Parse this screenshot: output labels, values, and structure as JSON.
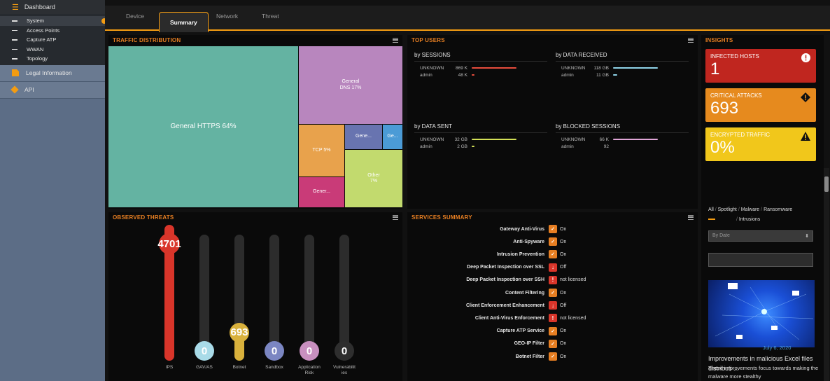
{
  "sidebar": {
    "dashboard": "Dashboard",
    "items": [
      "System",
      "Access Points",
      "Capture ATP",
      "WWAN",
      "Topology"
    ],
    "legal": "Legal Information",
    "api": "API"
  },
  "tabs": [
    "Device",
    "Summary",
    "Network",
    "Threat"
  ],
  "traffic": {
    "title": "TRAFFIC DISTRIBUTION",
    "cells": [
      "General HTTPS 64%",
      "General\nDNS 17%",
      "TCP 5%",
      "Gene...",
      "Ge...",
      "Other\n7%",
      "Gener..."
    ]
  },
  "top_users": {
    "title": "TOP USERS",
    "sections": [
      {
        "title": "by SESSIONS",
        "rows": [
          {
            "name": "UNKNOWN",
            "value": "869 K",
            "color": "#e74c3c",
            "frac": 1.0
          },
          {
            "name": "admin",
            "value": "48 K",
            "color": "#e74c3c",
            "frac": 0.055
          }
        ]
      },
      {
        "title": "by DATA RECEIVED",
        "rows": [
          {
            "name": "UNKNOWN",
            "value": "118 GB",
            "color": "#8fd3e8",
            "frac": 1.0
          },
          {
            "name": "admin",
            "value": "11 GB",
            "color": "#8fd3e8",
            "frac": 0.093
          }
        ]
      },
      {
        "title": "by DATA SENT",
        "rows": [
          {
            "name": "UNKNOWN",
            "value": "32 GB",
            "color": "#d4e157",
            "frac": 1.0
          },
          {
            "name": "admin",
            "value": "2 GB",
            "color": "#d4e157",
            "frac": 0.0625
          }
        ]
      },
      {
        "title": "by BLOCKED SESSIONS",
        "rows": [
          {
            "name": "UNKNOWN",
            "value": "66 K",
            "color": "#e1a6d8",
            "frac": 1.0
          },
          {
            "name": "admin",
            "value": "92",
            "color": "#e1a6d8",
            "frac": 0.0
          }
        ]
      }
    ]
  },
  "threats": {
    "title": "OBSERVED THREATS",
    "items": [
      {
        "label": "IPS",
        "value": "4701",
        "color": "#d9352a",
        "frac": 1.0
      },
      {
        "label": "GAV/AS",
        "value": "0",
        "color": "#a9dbe8",
        "frac": 0
      },
      {
        "label": "Botnet",
        "value": "693",
        "color": "#d9b13c",
        "frac": 0.147
      },
      {
        "label": "Sandbox",
        "value": "0",
        "color": "#7b86c2",
        "frac": 0
      },
      {
        "label": "Application\nRisk",
        "value": "0",
        "color": "#c88fbf",
        "frac": 0
      },
      {
        "label": "Vulnerabilit\nies",
        "value": "0",
        "color": "#3a3a3a",
        "frac": 0
      }
    ]
  },
  "services": {
    "title": "SERVICES SUMMARY",
    "rows": [
      {
        "name": "Gateway Anti-Virus",
        "status": "On",
        "kind": "on"
      },
      {
        "name": "Anti-Spyware",
        "status": "On",
        "kind": "on"
      },
      {
        "name": "Intrusion Prevention",
        "status": "On",
        "kind": "on"
      },
      {
        "name": "Deep Packet Inspection over SSL",
        "status": "Off",
        "kind": "off"
      },
      {
        "name": "Deep Packet Inspection over SSH",
        "status": "not licensed",
        "kind": "nl"
      },
      {
        "name": "Content Filtering",
        "status": "On",
        "kind": "on"
      },
      {
        "name": "Client Enforcement Enhancement",
        "status": "Off",
        "kind": "off"
      },
      {
        "name": "Client Anti-Virus Enforcement",
        "status": "not licensed",
        "kind": "nl"
      },
      {
        "name": "Capture ATP Service",
        "status": "On",
        "kind": "on"
      },
      {
        "name": "GEO-IP Filter",
        "status": "On",
        "kind": "on"
      },
      {
        "name": "Botnet Filter",
        "status": "On",
        "kind": "on"
      }
    ]
  },
  "insights": {
    "title": "INSIGHTS",
    "cards": [
      {
        "label": "INFECTED HOSTS",
        "value": "1",
        "color": "#c0261f",
        "icon": "!"
      },
      {
        "label": "CRITICAL ATTACKS",
        "value": "693",
        "color": "#e68a1e",
        "icon": "!"
      },
      {
        "label": "ENCRYPTED TRAFFIC",
        "value": "0%",
        "color": "#f1c71b",
        "icon": "!"
      }
    ],
    "filters": [
      "All",
      "Spotlight",
      "Malware",
      "Ransomware",
      "Intrusions"
    ],
    "select": "By Date",
    "article_title": "Improvements in malicious Excel files distributi ...",
    "article_date": "July 6, 2020",
    "article_text": "These improvements focus towards making the malware more stealthy"
  }
}
